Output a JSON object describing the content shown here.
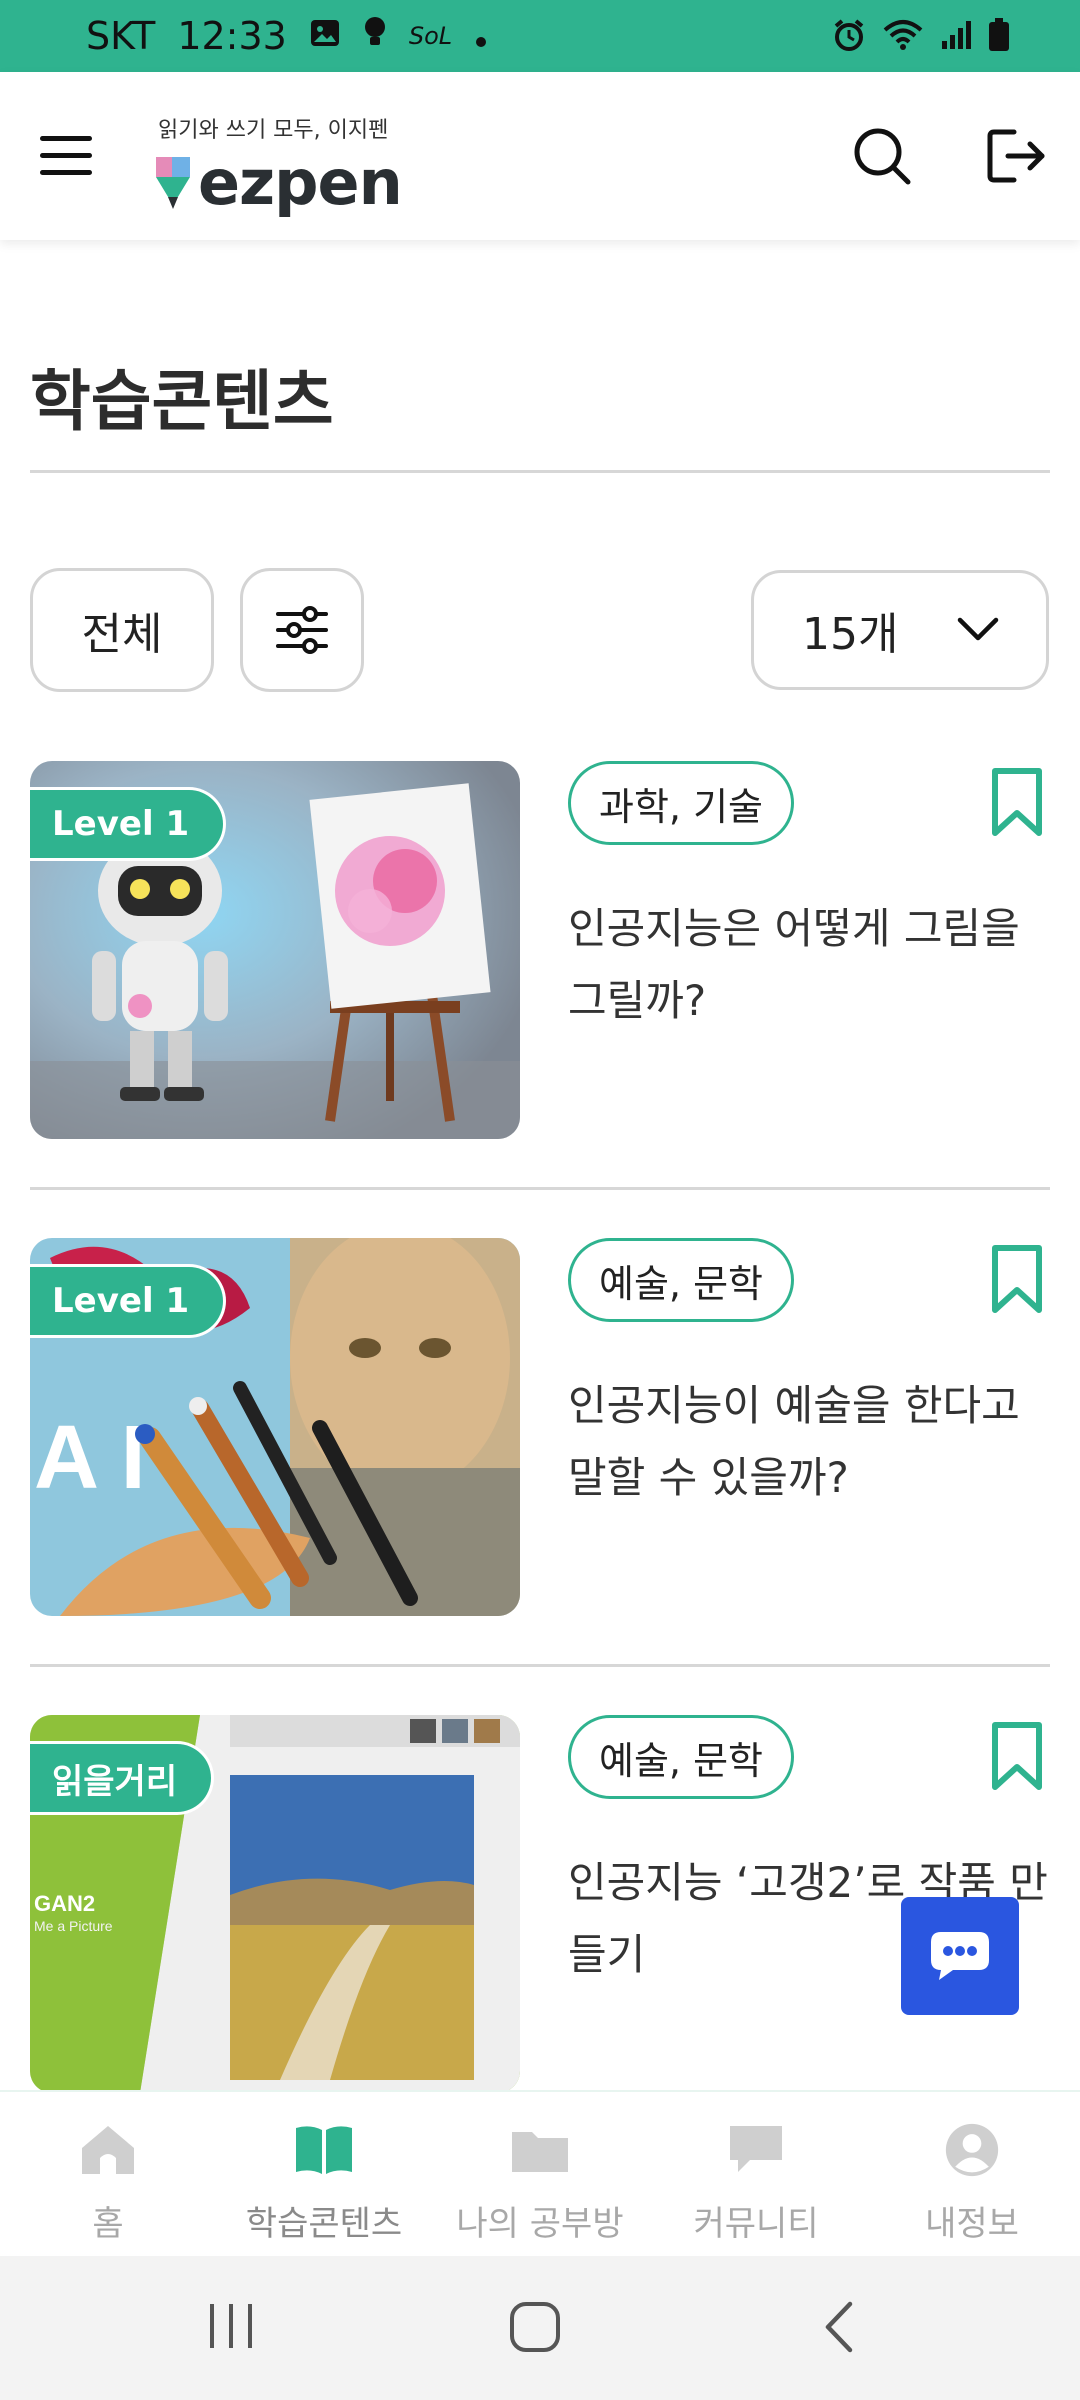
{
  "status_bar": {
    "carrier": "SKT",
    "time": "12:33",
    "icons": [
      "image-icon",
      "bulb-icon",
      "sol-icon",
      "dot-icon",
      "alarm-icon",
      "wifi-icon",
      "signal-icon",
      "battery-icon"
    ],
    "sol_text": "SoL"
  },
  "header": {
    "tagline": "읽기와 쓰기 모두, 이지펜",
    "brand": "ezpen",
    "icons": [
      "menu-icon",
      "search-icon",
      "logout-icon"
    ]
  },
  "page": {
    "title": "학습콘텐츠"
  },
  "filters": {
    "all_label": "전체",
    "count_label": "15개"
  },
  "cards": [
    {
      "badge": "Level 1",
      "category": "과학, 기술",
      "title": "인공지능은 어떻게 그림을 그릴까?"
    },
    {
      "badge": "Level 1",
      "category": "예술, 문학",
      "title": "인공지능이 예술을 한다고 말할 수 있을까?",
      "thumb_text": "A I"
    },
    {
      "badge": "읽을거리",
      "category": "예술, 문학",
      "title": "인공지능 ‘고갱2’로 작품 만들기",
      "thumb_text": "GAN2",
      "thumb_subtext": "Me a Picture"
    }
  ],
  "bottom_nav": [
    {
      "label": "홈",
      "icon": "home-icon"
    },
    {
      "label": "학습콘텐츠",
      "icon": "book-icon"
    },
    {
      "label": "나의 공부방",
      "icon": "folder-icon"
    },
    {
      "label": "커뮤니티",
      "icon": "chat-bubble-icon"
    },
    {
      "label": "내정보",
      "icon": "profile-icon"
    }
  ],
  "colors": {
    "accent": "#2fb38f",
    "chat_button": "#2a56e0",
    "text": "#222222",
    "muted": "#a8a8a8"
  }
}
